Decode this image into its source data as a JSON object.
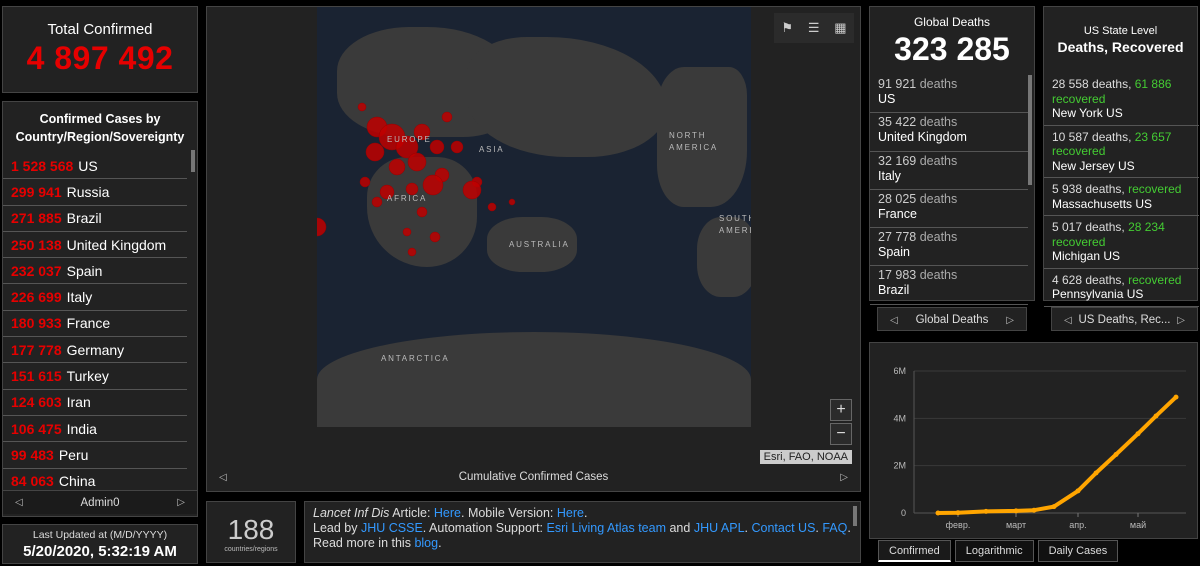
{
  "total": {
    "label": "Total Confirmed",
    "value": "4 897 492"
  },
  "country_panel": {
    "header": "Confirmed Cases by Country/Region/Sovereignty",
    "items": [
      {
        "n": "1 528 568",
        "name": "US"
      },
      {
        "n": "299 941",
        "name": "Russia"
      },
      {
        "n": "271 885",
        "name": "Brazil"
      },
      {
        "n": "250 138",
        "name": "United Kingdom"
      },
      {
        "n": "232 037",
        "name": "Spain"
      },
      {
        "n": "226 699",
        "name": "Italy"
      },
      {
        "n": "180 933",
        "name": "France"
      },
      {
        "n": "177 778",
        "name": "Germany"
      },
      {
        "n": "151 615",
        "name": "Turkey"
      },
      {
        "n": "124 603",
        "name": "Iran"
      },
      {
        "n": "106 475",
        "name": "India"
      },
      {
        "n": "99 483",
        "name": "Peru"
      },
      {
        "n": "84 063",
        "name": "China"
      }
    ],
    "pager_label": "Admin0"
  },
  "updated": {
    "label": "Last Updated at (M/D/YYYY)",
    "value": "5/20/2020, 5:32:19 AM"
  },
  "map": {
    "labels": {
      "europe": "EUROPE",
      "asia": "ASIA",
      "africa": "AFRICA",
      "australia": "AUSTRALIA",
      "north_america": "NORTH AMERICA",
      "south_america": "SOUTH AMERICA",
      "antarctica": "ANTARCTICA"
    },
    "attribution": "Esri, FAO, NOAA",
    "pager_label": "Cumulative Confirmed Cases",
    "zoom_in": "+",
    "zoom_out": "−",
    "tool_icons": [
      "bookmark-icon",
      "list-icon",
      "qr-grid-icon"
    ]
  },
  "countries_count": {
    "value": "188",
    "label": "countries/regions"
  },
  "info": {
    "t1": "Lancet Inf Dis",
    "t2": " Article: ",
    "l_here1": "Here",
    "t3": ". Mobile Version: ",
    "l_here2": "Here",
    "t4": ".",
    "t5": "Lead by ",
    "l_jhu": "JHU CSSE",
    "t6": ". Automation Support: ",
    "l_esri": "Esri Living Atlas team",
    "t7": " and ",
    "l_apl": "JHU APL",
    "t8": ". ",
    "l_contact": "Contact US",
    "t9": ". ",
    "l_faq": "FAQ",
    "t10": ". Read more in this ",
    "l_blog": "blog",
    "t11": "."
  },
  "global_deaths": {
    "label": "Global Deaths",
    "value": "323 285",
    "rows": [
      {
        "v": "91 921",
        "w": "deaths",
        "c": "US"
      },
      {
        "v": "35 422",
        "w": "deaths",
        "c": "United Kingdom"
      },
      {
        "v": "32 169",
        "w": "deaths",
        "c": "Italy"
      },
      {
        "v": "28 025",
        "w": "deaths",
        "c": "France"
      },
      {
        "v": "27 778",
        "w": "deaths",
        "c": "Spain"
      },
      {
        "v": "17 983",
        "w": "deaths",
        "c": "Brazil"
      }
    ],
    "pager_label": "Global Deaths"
  },
  "us_state": {
    "label": "US State Level",
    "sub": "Deaths, Recovered",
    "rows": [
      {
        "d": "28 558 deaths,",
        "r": "61 886",
        "rw": "recovered",
        "s": "New York US"
      },
      {
        "d": "10 587 deaths,",
        "r": "23 657",
        "rw": "recovered",
        "s": "New Jersey US"
      },
      {
        "d": "5 938 deaths,",
        "r": "",
        "rw": "recovered",
        "s": "Massachusetts US"
      },
      {
        "d": "5 017 deaths,",
        "r": "28 234",
        "rw": "recovered",
        "s": "Michigan US"
      },
      {
        "d": "4 628 deaths,",
        "r": "",
        "rw": "recovered",
        "s": "Pennsylvania US"
      }
    ],
    "pager_label": "US Deaths, Rec..."
  },
  "tabs": [
    "Confirmed",
    "Logarithmic",
    "Daily Cases"
  ],
  "colors": {
    "accent_red": "#e60000",
    "recovered_green": "#44cc33",
    "line_orange": "#ffa500",
    "link_blue": "#3399ff"
  },
  "chart_data": {
    "type": "line",
    "title": "",
    "xlabel": "",
    "ylabel": "",
    "x_ticks": [
      "февр.",
      "март",
      "апр.",
      "май"
    ],
    "y_ticks": [
      "0",
      "2M",
      "4M",
      "6M"
    ],
    "ylim": [
      0,
      6000000
    ],
    "x": [
      "2020-01-22",
      "2020-02-01",
      "2020-02-15",
      "2020-03-01",
      "2020-03-10",
      "2020-03-20",
      "2020-04-01",
      "2020-04-10",
      "2020-04-20",
      "2020-05-01",
      "2020-05-10",
      "2020-05-20"
    ],
    "values": [
      555,
      12000,
      69000,
      88000,
      119000,
      272000,
      932000,
      1690000,
      2470000,
      3350000,
      4100000,
      4897492
    ],
    "grid": true
  }
}
